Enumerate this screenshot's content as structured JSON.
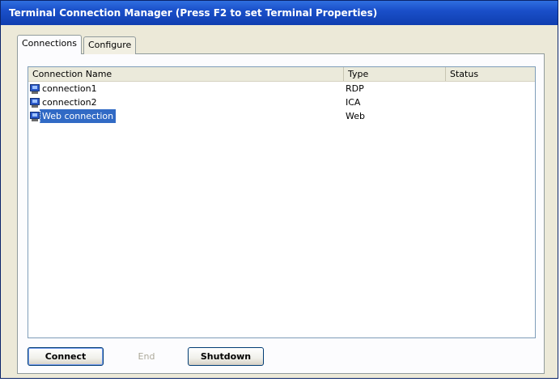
{
  "window": {
    "title": "Terminal Connection Manager (Press F2 to set Terminal Properties)"
  },
  "tabs": [
    {
      "label": "Connections",
      "active": true
    },
    {
      "label": "Configure",
      "active": false
    }
  ],
  "list": {
    "columns": [
      {
        "label": "Connection Name"
      },
      {
        "label": "Type"
      },
      {
        "label": "Status"
      }
    ],
    "rows": [
      {
        "name": "connection1",
        "type": "RDP",
        "status": "",
        "icon": "monitor-icon",
        "selected": false
      },
      {
        "name": "connection2",
        "type": "ICA",
        "status": "",
        "icon": "monitor-icon",
        "selected": false
      },
      {
        "name": "Web connection",
        "type": "Web",
        "status": "",
        "icon": "monitor-icon",
        "selected": true
      }
    ]
  },
  "buttons": {
    "connect": {
      "label": "Connect",
      "enabled": true
    },
    "end": {
      "label": "End",
      "enabled": false
    },
    "shutdown": {
      "label": "Shutdown",
      "enabled": true
    }
  },
  "colors": {
    "titlebar": "#1a4fc9",
    "selection": "#316ac5",
    "dialog_bg": "#ece9d8"
  }
}
